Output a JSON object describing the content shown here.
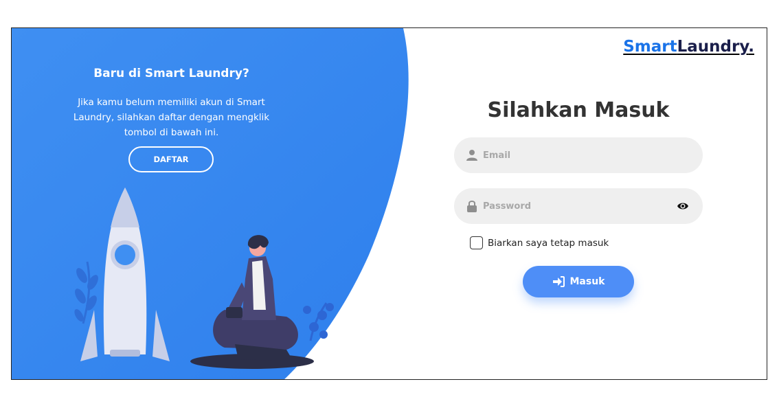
{
  "left_panel": {
    "title": "Baru di Smart Laundry?",
    "description": "Jika kamu belum memiliki akun di Smart Laundry, silahkan daftar dengan mengklik tombol di bawah ini.",
    "register_button_label": "DAFTAR"
  },
  "brand": {
    "part1": "Smart",
    "part2": "Laundry",
    "part3": "."
  },
  "login": {
    "heading": "Silahkan Masuk",
    "email_placeholder": "Email",
    "email_value": "",
    "password_placeholder": "Password",
    "password_value": "",
    "remember_label": "Biarkan saya tetap masuk",
    "remember_checked": false,
    "submit_label": "Masuk"
  },
  "icons": {
    "email": "user-icon",
    "password": "lock-icon",
    "toggle_password": "eye-icon",
    "submit": "sign-in-icon"
  },
  "colors": {
    "primary_blue": "#3a8ef0",
    "brand_smart": "#1a73e8",
    "brand_laundry": "#1b1f4b",
    "button_blue": "#4e8ef7",
    "field_bg": "#efefef",
    "heading_text": "#333333"
  }
}
